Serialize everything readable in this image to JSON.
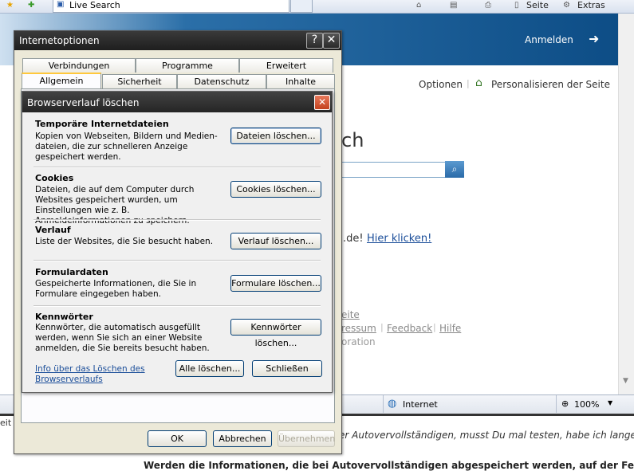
{
  "ie": {
    "tab_title": "Live Search",
    "page_menu": "Seite",
    "tools_menu": "Extras",
    "signin": "Anmelden",
    "options": "Optionen",
    "personalize": "Personalisieren der Seite",
    "search_heading_partial": "ch",
    "promo_text": ".de!",
    "promo_link": "Hier klicken!",
    "footer_partial1": "eite",
    "footer_partial2": "ressum",
    "footer_feedback": "Feedback",
    "footer_help": "Hilfe",
    "footer_sep": "|",
    "footer_partial3": "oration",
    "status_zone": "Internet",
    "zoom": "100%",
    "left_partial": "eit"
  },
  "page_text": {
    "line1": "er Autovervollständigen, musst Du mal testen, habe ich lange",
    "line2": "Werden die Informationen, die bei Autovervollständigen abgespeichert werden, auf der Festp"
  },
  "inet_dialog": {
    "title": "Internetoptionen",
    "help_btn": "?",
    "close_btn": "✕",
    "tabs_back": [
      "Verbindungen",
      "Programme",
      "Erweitert"
    ],
    "tabs_front": [
      "Allgemein",
      "Sicherheit",
      "Datenschutz",
      "Inhalte"
    ],
    "ok": "OK",
    "cancel": "Abbrechen",
    "apply": "Übernehmen"
  },
  "delete_dialog": {
    "title": "Browserverlauf löschen",
    "close_btn": "✕",
    "sections": [
      {
        "title": "Temporäre Internetdateien",
        "desc": "Kopien von Webseiten, Bildern und Medien-dateien, die zur schnelleren Anzeige gespeichert werden.",
        "button": "Dateien löschen..."
      },
      {
        "title": "Cookies",
        "desc": "Dateien, die auf dem Computer durch Websites gespeichert wurden, um Einstellungen wie z. B. Anmeldeinformationen zu speichern.",
        "button": "Cookies löschen..."
      },
      {
        "title": "Verlauf",
        "desc": "Liste der Websites, die Sie besucht haben.",
        "button": "Verlauf löschen..."
      },
      {
        "title": "Formulardaten",
        "desc": "Gespeicherte Informationen, die Sie in Formulare eingegeben haben.",
        "button": "Formulare löschen..."
      },
      {
        "title": "Kennwörter",
        "desc": "Kennwörter, die automatisch ausgefüllt werden, wenn Sie sich an einer Website anmelden, die Sie bereits besucht haben.",
        "button": "Kennwörter löschen..."
      }
    ],
    "info_link": "Info über das Löschen des Browserverlaufs",
    "delete_all": "Alle löschen...",
    "close": "Schließen"
  }
}
